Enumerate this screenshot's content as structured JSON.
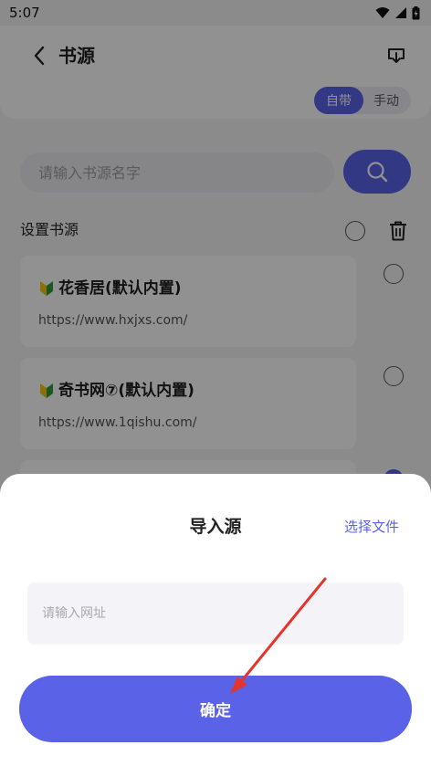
{
  "status_bar": {
    "time": "5:07"
  },
  "header": {
    "title": "书源",
    "toggle": {
      "selected": "自带",
      "other": "手动"
    }
  },
  "search": {
    "placeholder": "请输入书源名字"
  },
  "section": {
    "title": "设置书源"
  },
  "sources": [
    {
      "name": "花香居(默认内置)",
      "url": "https://www.hxjxs.com/"
    },
    {
      "name": "奇书网⑦(默认内置)",
      "url": "https://www.1qishu.com/"
    }
  ],
  "dialog": {
    "title": "导入源",
    "choose_file": "选择文件",
    "url_placeholder": "请输入网址",
    "confirm": "确定"
  },
  "colors": {
    "accent": "#5a63e8",
    "annotation_arrow": "#e5352b"
  }
}
